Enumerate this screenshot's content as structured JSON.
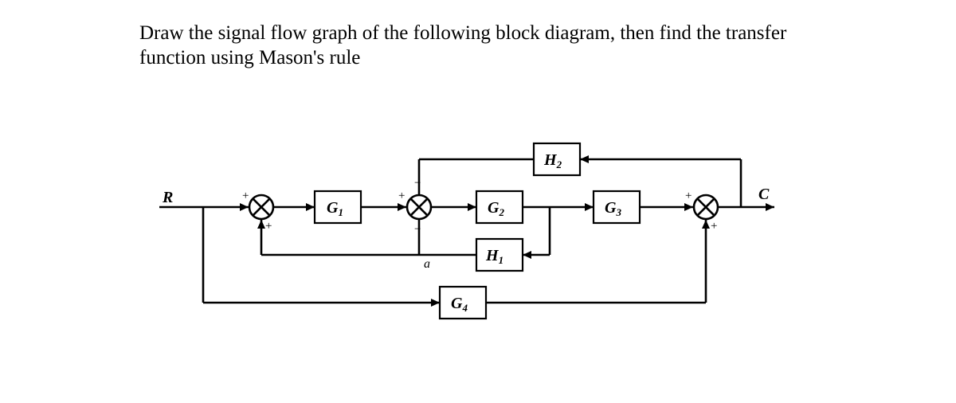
{
  "problem": {
    "line1": "Draw the signal flow graph of the following block diagram, then find the transfer",
    "line2": "function using Mason's rule"
  },
  "diagram": {
    "input_label": "R",
    "output_label": "C",
    "blocks": {
      "g1": "G",
      "g1_sub": "1",
      "g2": "G",
      "g2_sub": "2",
      "g3": "G",
      "g3_sub": "3",
      "g4": "G",
      "g4_sub": "4",
      "h1": "H",
      "h1_sub": "1",
      "h2": "H",
      "h2_sub": "2"
    },
    "signs": {
      "sum1_top": "+",
      "sum1_bot": "+",
      "sum2_top_left": "+",
      "sum2_top_right": "−",
      "sum2_bot": "−",
      "sum3_top": "+",
      "sum3_bot": "+"
    },
    "annot": {
      "a": "a"
    }
  }
}
